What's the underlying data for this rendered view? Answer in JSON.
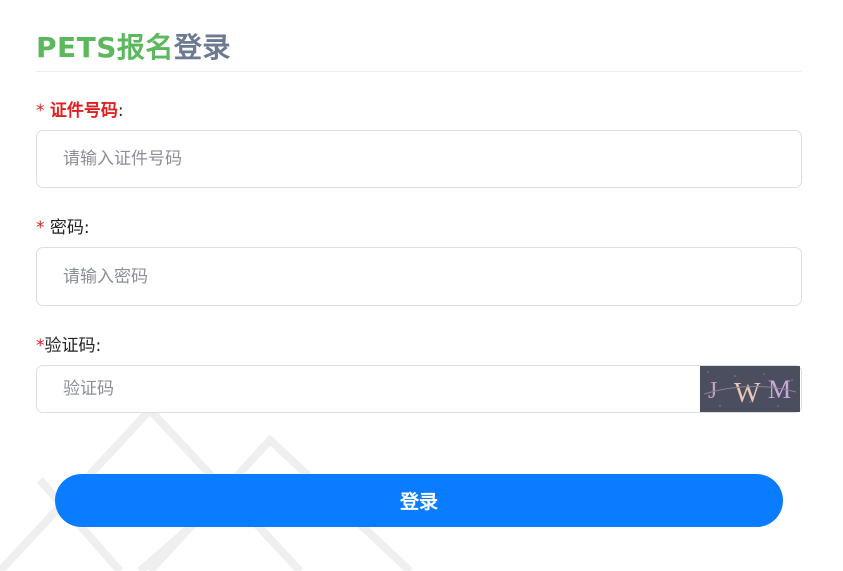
{
  "title": {
    "part1": "PETS报名",
    "part2": "登录"
  },
  "fields": {
    "id_number": {
      "required_mark": "*",
      "label": "证件号码",
      "colon": ":",
      "placeholder": "请输入证件号码",
      "value": ""
    },
    "password": {
      "required_mark": "*",
      "label": "密码",
      "colon": ":",
      "placeholder": "请输入密码",
      "value": ""
    },
    "captcha": {
      "required_mark": "*",
      "label": "验证码",
      "colon": ":",
      "placeholder": "验证码",
      "value": "",
      "image_text": "JWM"
    }
  },
  "login_button": {
    "label": "登录"
  },
  "colors": {
    "title_green": "#5cb85c",
    "title_gray": "#6b7a90",
    "required_red": "#e02020",
    "button_blue": "#0a7cff"
  }
}
